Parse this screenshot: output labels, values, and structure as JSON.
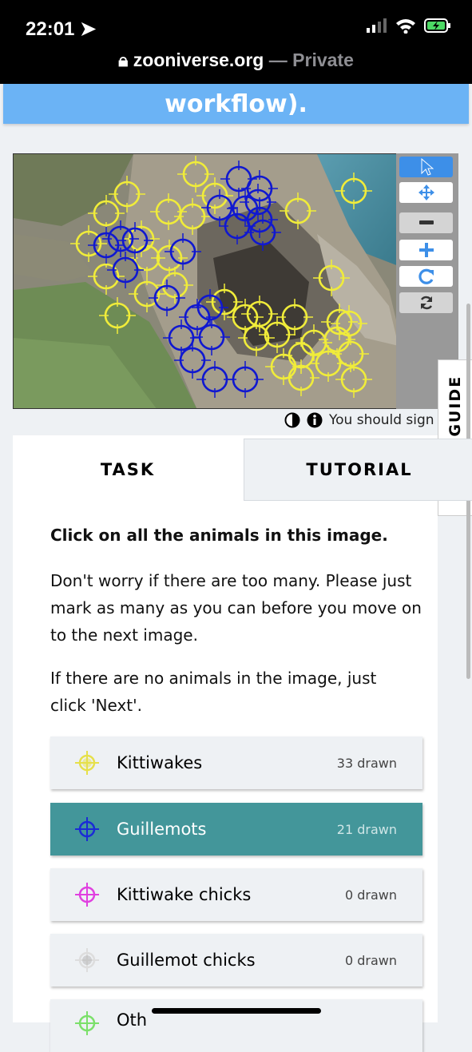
{
  "status": {
    "time": "22:01"
  },
  "browser": {
    "host": "zooniverse.org",
    "separator": " — ",
    "mode": "Private"
  },
  "banner": {
    "text": "workflow)."
  },
  "viewer_meta": {
    "notice": "You should sign"
  },
  "field_guide": {
    "label": "FIELD GUIDE"
  },
  "tabs": [
    {
      "label": "TASK"
    },
    {
      "label": "TUTORIAL"
    }
  ],
  "task": {
    "question": "Click on all the animals in this image.",
    "help_1": "Don't worry if there are too many. Please just mark as many as you can before you move on to the next image.",
    "help_2": "If there are no animals in the image, just click 'Next'."
  },
  "choices": [
    {
      "label": "Kittiwakes",
      "count": "33 drawn",
      "color": "#e6e04a"
    },
    {
      "label": "Guillemots",
      "count": "21 drawn",
      "color": "#1a2bd6"
    },
    {
      "label": "Kittiwake chicks",
      "count": "0 drawn",
      "color": "#e040e0"
    },
    {
      "label": "Guillemot chicks",
      "count": "0 drawn",
      "color": "#dddddd"
    },
    {
      "label": "Oth",
      "count": "",
      "color": "#7be06a"
    }
  ],
  "colors": {
    "kittiwake": "#f0ec3a",
    "guillemot": "#1018d0",
    "banner": "#6bb3f5",
    "selected": "#43969a"
  }
}
